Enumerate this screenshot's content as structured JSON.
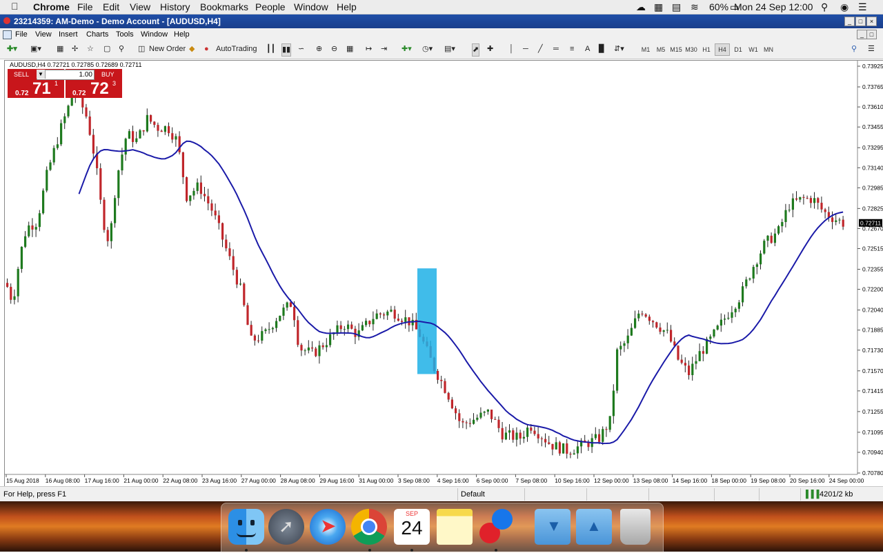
{
  "menubar": {
    "app": "Chrome",
    "items": [
      "File",
      "Edit",
      "View",
      "History",
      "Bookmarks",
      "People",
      "Window",
      "Help"
    ],
    "battery": "60%",
    "datetime": "Mon 24 Sep  12:00"
  },
  "window": {
    "title": "23214359: AM-Demo - Demo Account - [AUDUSD,H4]",
    "menu": [
      "File",
      "View",
      "Insert",
      "Charts",
      "Tools",
      "Window",
      "Help"
    ]
  },
  "toolbar": {
    "new_order": "New Order",
    "autotrading": "AutoTrading",
    "timeframes": [
      "M1",
      "M5",
      "M15",
      "M30",
      "H1",
      "H4",
      "D1",
      "W1",
      "MN"
    ],
    "active_timeframe": "H4"
  },
  "chart": {
    "symbol_info": "AUDUSD,H4  0.72721 0.72785 0.72689 0.72711",
    "price_labels": [
      "0.73925",
      "0.73765",
      "0.73610",
      "0.73455",
      "0.73295",
      "0.73140",
      "0.72985",
      "0.72825",
      "0.72670",
      "0.72515",
      "0.72355",
      "0.72200",
      "0.72040",
      "0.71885",
      "0.71730",
      "0.71570",
      "0.71415",
      "0.71255",
      "0.71095",
      "0.70940",
      "0.70780"
    ],
    "current_price": "0.72711",
    "date_labels": [
      "15 Aug 2018",
      "16 Aug 08:00",
      "17 Aug 16:00",
      "21 Aug 00:00",
      "22 Aug 08:00",
      "23 Aug 16:00",
      "27 Aug 00:00",
      "28 Aug 08:00",
      "29 Aug 16:00",
      "31 Aug 00:00",
      "3 Sep 08:00",
      "4 Sep 16:00",
      "6 Sep 00:00",
      "7 Sep 08:00",
      "10 Sep 16:00",
      "12 Sep 00:00",
      "13 Sep 08:00",
      "14 Sep 16:00",
      "18 Sep 00:00",
      "19 Sep 08:00",
      "20 Sep 16:00",
      "24 Sep 00:00"
    ],
    "colors": {
      "bull": "#1e7a1e",
      "bear": "#c0262b",
      "ma": "#1a1aa8",
      "highlight": "#1fb0e6"
    }
  },
  "trade_panel": {
    "sell_label": "SELL",
    "buy_label": "BUY",
    "lot": "1.00",
    "sell_prefix": "0.72",
    "sell_big": "71",
    "sell_sup": "1",
    "buy_prefix": "0.72",
    "buy_big": "72",
    "buy_sup": "3"
  },
  "status": {
    "help": "For Help, press F1",
    "profile": "Default",
    "traffic": "4201/2 kb"
  },
  "dock": {
    "calendar_month": "SEP",
    "calendar_day": "24",
    "icons": [
      "finder-icon",
      "launchpad-icon",
      "safari-icon",
      "chrome-icon",
      "calendar-icon",
      "notes-icon",
      "app-icon",
      "downloads-folder-icon",
      "drive-folder-icon",
      "trash-icon"
    ]
  }
}
